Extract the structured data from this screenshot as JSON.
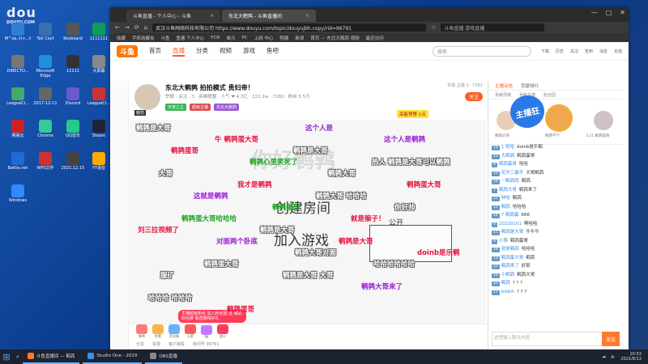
{
  "watermark": {
    "text": "dou",
    "sub": "DOUYU.COM"
  },
  "desktop_icons": [
    {
      "label": "M^xa..t(+...t",
      "color": "#2d7fd3"
    },
    {
      "label": "Tail Coyt",
      "color": "#3a6fb2"
    },
    {
      "label": "Keyboard",
      "color": "#555"
    },
    {
      "label": "1111111",
      "color": "#0e9d58"
    },
    {
      "label": "DIRECTO...",
      "color": "#777"
    },
    {
      "label": "Microsoft Edge",
      "color": "#1f8fe0"
    },
    {
      "label": "11111",
      "color": "#333"
    },
    {
      "label": "大屏幕",
      "color": "#888"
    },
    {
      "label": "LeagueCl...",
      "color": "#4a6"
    },
    {
      "label": "2017-12-11",
      "color": "#666"
    },
    {
      "label": "Discord",
      "color": "#6a5acd"
    },
    {
      "label": "LeagueCl...",
      "color": "#c33"
    },
    {
      "label": "网易云",
      "color": "#c22"
    },
    {
      "label": "Chrome",
      "color": "#3c9"
    },
    {
      "label": "QQ音乐",
      "color": "#2c8"
    },
    {
      "label": "Steam",
      "color": "#223"
    },
    {
      "label": "Battle.net",
      "color": "#1e6bd6"
    },
    {
      "label": "WPS文件",
      "color": "#c33"
    },
    {
      "label": "2021.12.15",
      "color": "#444"
    },
    {
      "label": "YY语音",
      "color": "#fa0"
    },
    {
      "label": "Windows",
      "color": "#38f"
    }
  ],
  "browser": {
    "tabs": [
      {
        "label": "斗鱼直播 - 个人中心 - 斗鱼"
      },
      {
        "label": "东北大鹌鹑 - 斗鱼直播间"
      }
    ],
    "url": "武汉斗鱼网络科技有限公司 https://www.douyu.com/topic/douyujbh.copy/rid=96791",
    "search_placeholder": "斗鱼直播 游戏直播",
    "bookmarks": [
      "收藏",
      "手机收藏夹",
      "斗鱼",
      "鱼塘 个人中心",
      "FCN",
      "单元",
      "PC",
      "上网 中心",
      "鸭腿",
      "新浪",
      "首页 — 东北大鹌鹑 视频",
      "最近访问"
    ],
    "win_controls": [
      "—",
      "□",
      "✕"
    ]
  },
  "douyu_header": {
    "logo": "斗鱼",
    "nav": [
      "首页",
      "直播",
      "分类",
      "视频",
      "游戏",
      "鱼吧"
    ],
    "active_nav": "直播",
    "search_placeholder": "搜索",
    "icons": [
      "下载",
      "历史",
      "关注",
      "签到",
      "消息",
      "充值"
    ]
  },
  "room": {
    "title": "东北大鹌鹑 拍拍模式 贵妇帝！",
    "meta": "举报 · 关注 · 3 · 英雄联盟 · 人气 ❤ 4.3亿 · 222.1w · 7282 · 粉丝 5.5万",
    "tags": [
      "天宫之主",
      "超级主播",
      "东北大鹌鹑"
    ],
    "badge": "高能预警·1点",
    "report": "举报 主播 3 · 7282",
    "follow": "关注",
    "avatar_name": "鹌鹑"
  },
  "player": {
    "danmaku": [
      {
        "text": "鹌鹑是大哥",
        "color": "white"
      },
      {
        "text": "牛 鹌鹑蛋大哥",
        "color": "red"
      },
      {
        "text": "鹌鹑是大哥",
        "color": "white"
      },
      {
        "text": "热人 鹌鹑是大哥可以鹌鹑",
        "color": "white"
      },
      {
        "text": "大哥",
        "color": "white"
      },
      {
        "text": "我才是鹌鹑",
        "color": "red"
      },
      {
        "text": "鹌鹑大哥 哈哈哈",
        "color": "white"
      },
      {
        "text": "你好帅",
        "color": "white"
      },
      {
        "text": "鹌鹑蛋大哥哈哈哈",
        "color": "green"
      },
      {
        "text": "鹌鹑是大哥",
        "color": "white"
      },
      {
        "text": "鹌鹑是大哥",
        "color": "red"
      },
      {
        "text": "doinb是乐鹌",
        "color": "red"
      },
      {
        "text": "鹌鹑蛋大哥",
        "color": "white"
      },
      {
        "text": "鹌鹑是大哥 大哥",
        "color": "white"
      },
      {
        "text": "鹌鹑大哥来了",
        "color": "purple"
      },
      {
        "text": "哈哈哈 哈哈哈",
        "color": "white"
      },
      {
        "text": "鹌鹑蛋哥",
        "color": "red"
      },
      {
        "text": "这个人是",
        "color": "purple"
      },
      {
        "text": "这个人是鹌鹑",
        "color": "purple"
      },
      {
        "text": "鹌鹑蛋哥",
        "color": "red"
      },
      {
        "text": "鹌鹑心里笑死了",
        "color": "green"
      },
      {
        "text": "鹌鹑大哥",
        "color": "white"
      },
      {
        "text": "鹌鹑蛋大哥",
        "color": "red"
      },
      {
        "text": "这就是鹌鹑",
        "color": "purple"
      },
      {
        "text": "鹌鹑蛋哥",
        "color": "green"
      },
      {
        "text": "就是猴子！",
        "color": "red"
      },
      {
        "text": "刘三拉视频了",
        "color": "red"
      },
      {
        "text": "对面两个卧底",
        "color": "purple"
      },
      {
        "text": "鹌鹑大哥对面",
        "color": "white"
      },
      {
        "text": "哈哈哈哈哈哈",
        "color": "white"
      },
      {
        "text": "服了",
        "color": "white"
      }
    ],
    "watermark": "你好鹌鹑",
    "handwriting": [
      "创建房间",
      "加入游戏",
      "公开"
    ],
    "promo": "主播超级粉丝 加入粉丝团 送 鹌鹑 粉丝牌 看直播得好礼"
  },
  "controls": {
    "gifts": [
      "鹌鹑",
      "钞票",
      "荧光棒",
      "火箭",
      "PK",
      "超火"
    ],
    "colors": [
      "#ff7a7a",
      "#ffb24a",
      "#6ab0ff",
      "#ff5a5a",
      "#c07aff",
      "#ff3b5c"
    ]
  },
  "bottom": {
    "items": [
      "分享",
      "举报",
      "客户端看",
      "房间号 96791"
    ]
  },
  "right_panel": {
    "tabs": [
      "主播动态",
      "贡献排行"
    ],
    "subtabs": [
      "贡献周榜",
      "贡献总榜",
      "粉丝团"
    ],
    "rank": [
      {
        "name": "鹌鹑大哥",
        "color": "#e8d0b8"
      },
      {
        "name": "鹌鹑不下",
        "color": "#f0a850"
      },
      {
        "name": "3:21 鹌鹑蛋哥",
        "color": "#d0c0c8"
      }
    ],
    "chat": [
      {
        "lv": "14",
        "name": "1 哈哈",
        "text": "doinb是乐鹌"
      },
      {
        "lv": "21",
        "name": "大鹌鹑",
        "text": "鹌鹑蛋哥"
      },
      {
        "lv": "8",
        "name": "鹌鹑蛋哥",
        "text": "哈哈"
      },
      {
        "lv": "19",
        "name": "花开三春不",
        "text": "大哥鹌鹑"
      },
      {
        "lv": "16",
        "name": "一鹌鹑雨",
        "text": "鹌鹑"
      },
      {
        "lv": "7",
        "name": "鹌鹑大哥",
        "text": "鹌鹑来了"
      },
      {
        "lv": "11",
        "name": "钟哈",
        "text": "鹌鹑"
      },
      {
        "lv": "12",
        "name": "鹌鹑",
        "text": "哈哈哈"
      },
      {
        "lv": "24",
        "name": "7 鹌鹑蛋",
        "text": "666"
      },
      {
        "lv": "9",
        "name": "20210101",
        "text": "啊哈哈"
      },
      {
        "lv": "15",
        "name": "鹌鹑是大哥",
        "text": "牛牛牛"
      },
      {
        "lv": "6",
        "name": "小萌",
        "text": "鹌鹑蛋哥"
      },
      {
        "lv": "18",
        "name": "就是鹌鹑",
        "text": "哈哈哈"
      },
      {
        "lv": "13",
        "name": "鹌鹑蛋大哥",
        "text": "鹌鹑"
      },
      {
        "lv": "22",
        "name": "鹌鹑来了",
        "text": "好耶"
      },
      {
        "lv": "10",
        "name": "小鹌鹑",
        "text": "鹌鹑大哥"
      },
      {
        "lv": "20",
        "name": "鹌鹑",
        "text": "? ? ?"
      },
      {
        "lv": "17",
        "name": "bilibili",
        "text": "? ? ?"
      }
    ],
    "input_placeholder": "这里输入聊天内容",
    "send": "发送"
  },
  "sideflag": "主播狂",
  "taskbar": {
    "apps": [
      {
        "label": "斗鱼直播间 — 鹌鹑",
        "color": "#ff7a2c"
      },
      {
        "label": "Studio One - 2019",
        "color": "#3a8ee6"
      },
      {
        "label": "OBS直播",
        "color": "#888"
      }
    ],
    "time": "20:53",
    "date": "2021/8/12"
  }
}
